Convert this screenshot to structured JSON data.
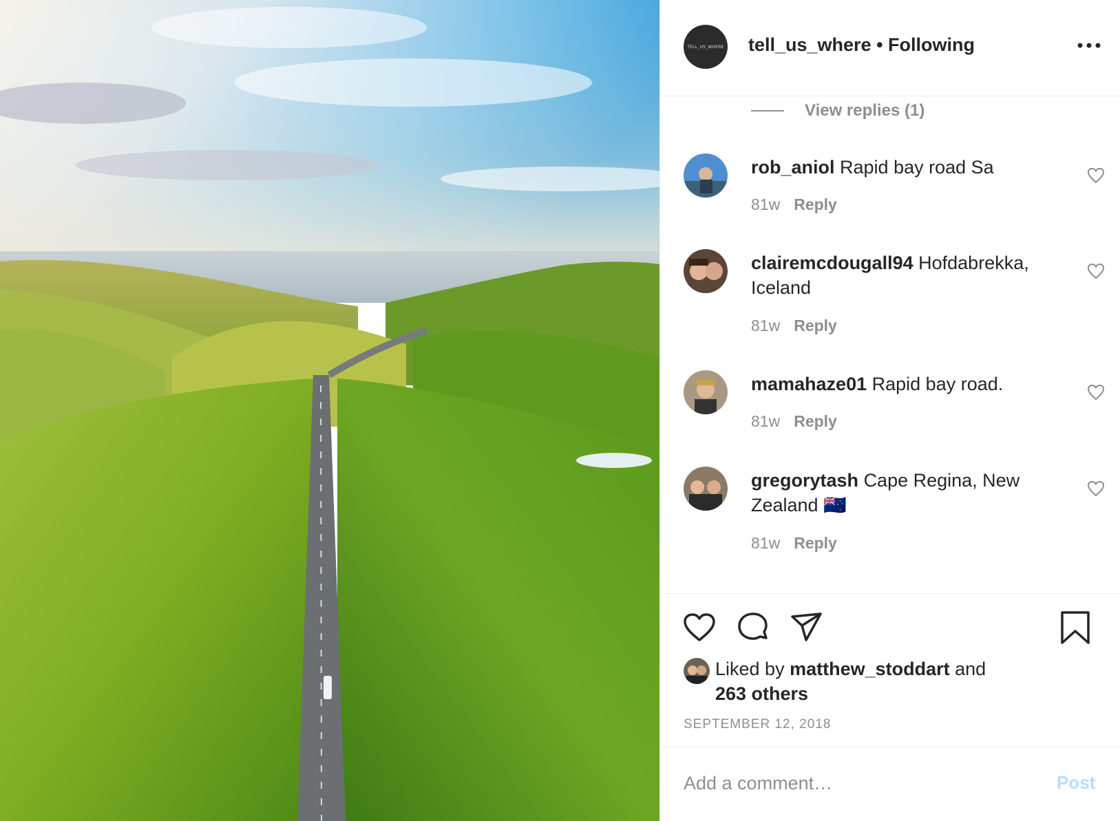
{
  "post": {
    "account": "tell_us_where",
    "avatar_text": "TELL_US_WHERE",
    "header_title": "tell_us_where • Following",
    "more_icon": "more-horizontal-icon"
  },
  "view_replies": "View replies (1)",
  "comments": [
    {
      "user": "rob_aniol",
      "text": "Rapid bay road Sa",
      "time": "81w",
      "reply": "Reply"
    },
    {
      "user": "clairemcdougall94",
      "text": "Hofdabrekka, Iceland",
      "time": "81w",
      "reply": "Reply"
    },
    {
      "user": "mamahaze01",
      "text": "Rapid bay road.",
      "time": "81w",
      "reply": "Reply"
    },
    {
      "user": "gregorytash",
      "text": "Cape Regina, New Zealand 🇳🇿",
      "time": "81w",
      "reply": "Reply"
    }
  ],
  "actions": {
    "like_icon": "heart-icon",
    "comment_icon": "comment-icon",
    "share_icon": "paper-plane-icon",
    "save_icon": "bookmark-icon"
  },
  "likes": {
    "prefix": "Liked by ",
    "user": "matthew_stoddart",
    "and": " and",
    "others": "263 others"
  },
  "date": "SEPTEMBER 12, 2018",
  "add_comment": {
    "placeholder": "Add a comment…",
    "post_label": "Post"
  },
  "colors": {
    "text": "#262626",
    "muted": "#8e8e8e",
    "post_disabled": "#b2dffc",
    "divider": "#efefef"
  }
}
